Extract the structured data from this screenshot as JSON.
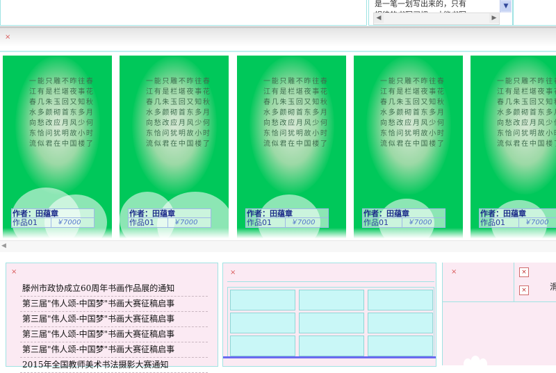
{
  "top": {
    "right_text_lines": [
      "是一笔一划写出来的，只有",
      "规律的书写习惯，才能书写"
    ],
    "scroll_up": "▲",
    "scroll_down": "▼",
    "scroll_left": "◀",
    "scroll_right": "▶"
  },
  "gallery": {
    "poem_lines": [
      "春花秋月何时了",
      "往事知多少小楼",
      "昨夜又东风故国",
      "不堪回首月明中",
      "雕栏玉砌应犹在",
      "只是朱颜改问君",
      "能有几多愁恰似",
      "一江春水向东流"
    ],
    "cards": [
      {
        "author": "作者：田蕴章",
        "work": "作品01",
        "price": "￥7000"
      },
      {
        "author": "作者：田蕴章",
        "work": "作品01",
        "price": "￥7000"
      },
      {
        "author": "作者：田蕴章",
        "work": "作品01",
        "price": "￥7000"
      },
      {
        "author": "作者：田蕴章",
        "work": "作品01",
        "price": "￥7000"
      },
      {
        "author": "作者：田蕴章",
        "work": "作品01",
        "price": "￥7000"
      }
    ],
    "scroll_left": "◀"
  },
  "news": {
    "items": [
      "滕州市政协成立60周年书画作品展的通知",
      "第三届\"伟人颂-中国梦\"书画大赛征稿启事",
      "第三届\"伟人颂-中国梦\"书画大赛征稿启事",
      "第三届\"伟人颂-中国梦\"书画大赛征稿启事",
      "第三届\"伟人颂-中国梦\"书画大赛征稿启事",
      "2015年全国教师美术书法摄影大赛通知"
    ]
  },
  "right": {
    "partial_char": "滑"
  },
  "icons": {
    "close": "×"
  },
  "colors": {
    "card_green": "#00c85a",
    "panel_pink": "#fbeaf3",
    "cell_cyan": "#c9f7f7",
    "border_cyan": "#9fe3e3",
    "accent_bar": "#6a6af0"
  }
}
